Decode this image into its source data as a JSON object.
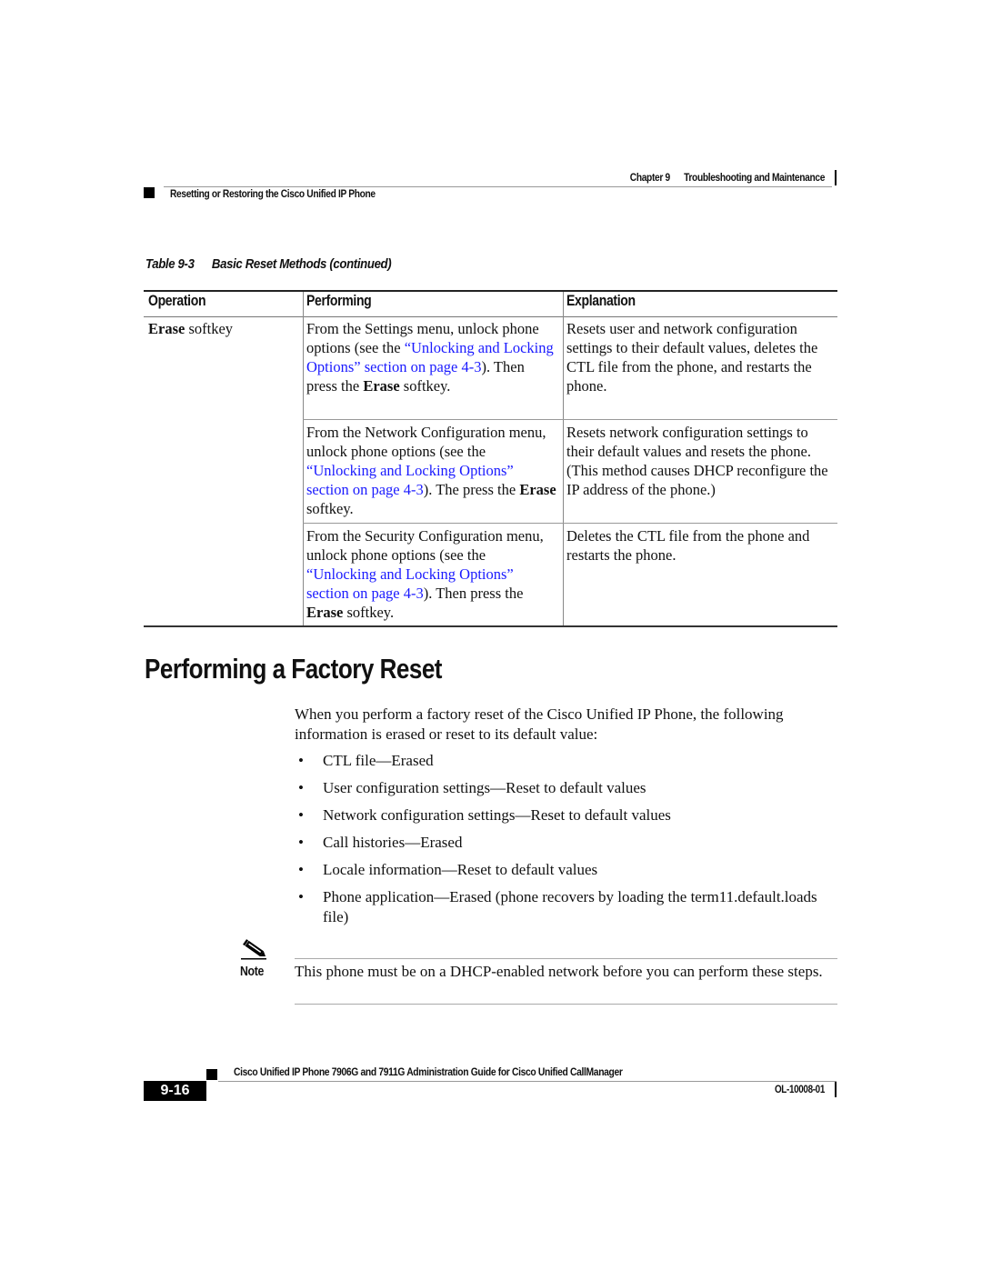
{
  "header": {
    "chapter_label": "Chapter 9",
    "chapter_title": "Troubleshooting and Maintenance",
    "section": "Resetting or Restoring the Cisco Unified IP Phone"
  },
  "table": {
    "caption_number": "Table 9-3",
    "caption_title": "Basic Reset Methods (continued)",
    "columns": [
      "Operation",
      "Performing",
      "Explanation"
    ],
    "operation": {
      "bold": "Erase",
      "rest": " softkey"
    },
    "rows": [
      {
        "performing": {
          "pre": "From the Settings menu, unlock phone options (see the ",
          "link": "“Unlocking and Locking Options” section on page 4-3",
          "post": "). Then press the ",
          "bold": "Erase",
          "tail": " softkey."
        },
        "explanation": "Resets user and network configuration settings to their default values, deletes the CTL file from the phone, and restarts the phone."
      },
      {
        "performing": {
          "pre": "From the Network Configuration menu, unlock phone options (see the ",
          "link": "“Unlocking and Locking Options” section on page 4-3",
          "post": "). The press the ",
          "bold": "Erase",
          "tail": " softkey."
        },
        "explanation": "Resets network configuration settings to their default values and resets the phone. (This method causes DHCP reconfigure the IP address of the phone.)"
      },
      {
        "performing": {
          "pre": "From the Security Configuration menu, unlock phone options (see the ",
          "link": "“Unlocking and Locking Options” section on page 4-3",
          "post": "). Then press the ",
          "bold": "Erase",
          "tail": " softkey."
        },
        "explanation": "Deletes the CTL file from the phone and restarts the phone."
      }
    ]
  },
  "section": {
    "title": "Performing a Factory Reset",
    "intro": "When you perform a factory reset of the Cisco Unified IP Phone, the following information is erased or reset to its default value:",
    "bullets": [
      "CTL file—Erased",
      "User configuration settings—Reset to default values",
      "Network configuration settings—Reset to default values",
      "Call histories—Erased",
      "Locale information—Reset to default values",
      "Phone application—Erased (phone recovers by loading the term11.default.loads file)"
    ],
    "bullet_glyph": "•"
  },
  "note": {
    "icon": "pencil-note-icon",
    "label": "Note",
    "text": "This phone must be on a DHCP-enabled network before you can perform these steps."
  },
  "footer": {
    "book_title": "Cisco Unified IP Phone 7906G and 7911G Administration Guide for Cisco Unified CallManager",
    "page_number": "9-16",
    "doc_number": "OL-10008-01"
  },
  "colors": {
    "link": "#1a1aff",
    "text": "#111111",
    "page_badge_bg": "#000000",
    "page_badge_fg": "#ffffff"
  }
}
